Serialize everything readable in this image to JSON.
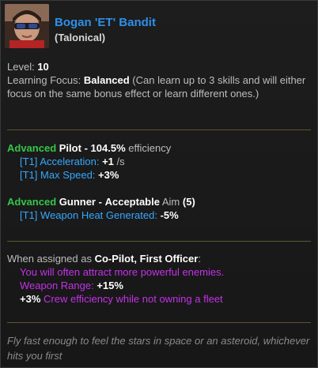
{
  "header": {
    "name": "Bogan 'ET' Bandit",
    "subtitle": "(Talonical)"
  },
  "info": {
    "level_label": "Level:",
    "level_value": "10",
    "focus_label": "Learning Focus:",
    "focus_value": "Balanced",
    "focus_desc": "(Can learn up to 3 skills and will either focus on the same bonus effect or learn different ones.)"
  },
  "skills": [
    {
      "rank": "Advanced",
      "role": "Pilot",
      "dash": "-",
      "value": "104.5%",
      "stat": "efficiency",
      "effects": [
        {
          "tier": "[T1]",
          "label": "Acceleration:",
          "value": "+1",
          "unit": "/s"
        },
        {
          "tier": "[T1]",
          "label": "Max Speed:",
          "value": "+3%",
          "unit": ""
        }
      ]
    },
    {
      "rank": "Advanced",
      "role": "Gunner",
      "dash": "-",
      "value": "Acceptable",
      "stat": "Aim",
      "extra": "(5)",
      "effects": [
        {
          "tier": "[T1]",
          "label": "Weapon Heat Generated:",
          "value": "-5%",
          "unit": ""
        }
      ]
    }
  ],
  "assignment": {
    "prefix": "When assigned as",
    "roles": "Co-Pilot, First Officer",
    "colon": ":",
    "line1": "You will often attract more powerful enemies.",
    "line2_label": "Weapon Range:",
    "line2_value": "+15%",
    "line3_value": "+3%",
    "line3_label": "Crew efficiency while not owning a fleet"
  },
  "flavor": "Fly fast enough to feel the stars in space or an asteroid, whichever hits you first",
  "colors": {
    "name": "#2e8fe8",
    "rank": "#34c64a",
    "effect": "#36a8ff",
    "assignment": "#c332e8",
    "separator": "#5e5436"
  }
}
